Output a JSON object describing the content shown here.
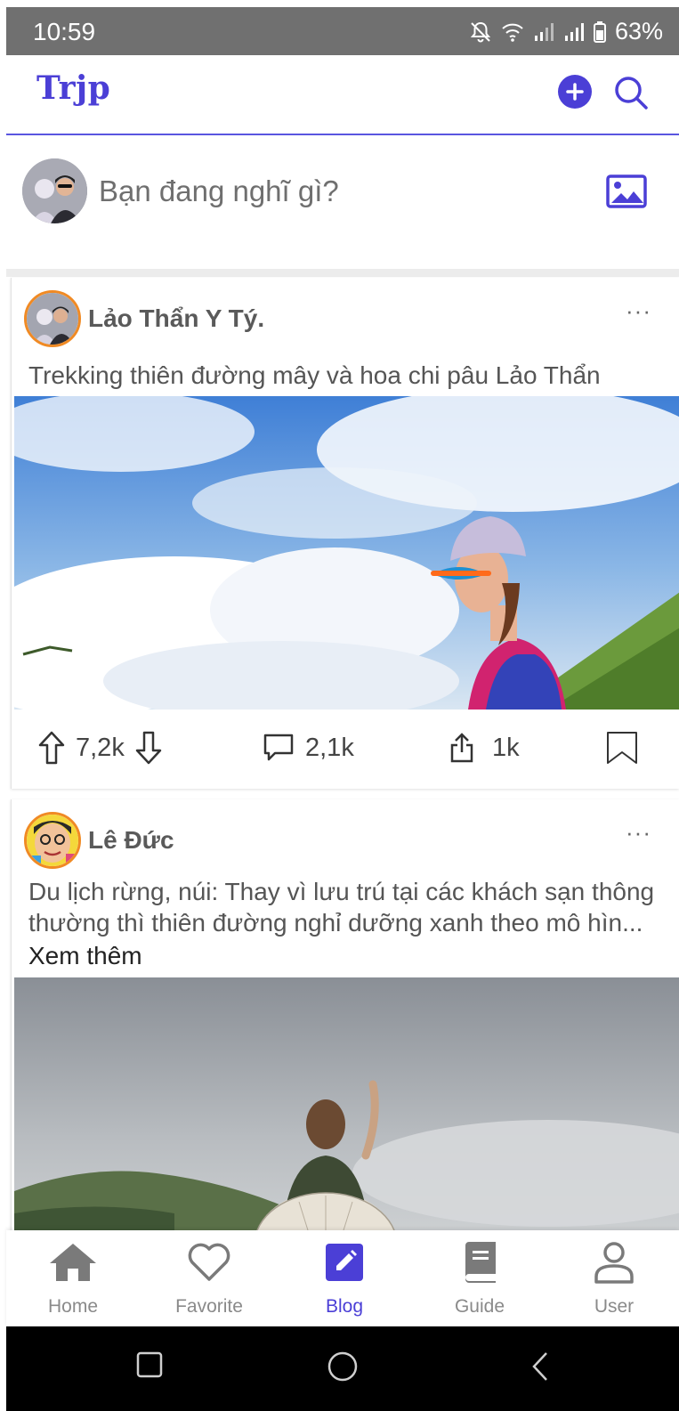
{
  "status_bar": {
    "time": "10:59",
    "battery": "63%"
  },
  "app": {
    "logo": "Trjp"
  },
  "composer": {
    "placeholder": "Bạn đang nghĩ gì?"
  },
  "posts": [
    {
      "author": "Lảo Thẩn Y Tý.",
      "more": "···",
      "caption": "Trekking thiên đường mây và hoa chi pâu Lảo Thẩn",
      "upvotes": "7,2k",
      "comments": "2,1k",
      "shares": "1k"
    },
    {
      "author": "Lê Đức",
      "more": "···",
      "caption": "Du lịch rừng, núi: Thay vì lưu trú tại các khách sạn thông thường thì thiên đường nghỉ dưỡng xanh theo mô hìn...",
      "see_more": "Xem thêm"
    }
  ],
  "bottom_nav": {
    "items": [
      {
        "label": "Home",
        "icon": "home-icon"
      },
      {
        "label": "Favorite",
        "icon": "heart-icon"
      },
      {
        "label": "Blog",
        "icon": "edit-icon",
        "active": true
      },
      {
        "label": "Guide",
        "icon": "book-icon"
      },
      {
        "label": "User",
        "icon": "user-icon"
      }
    ]
  },
  "colors": {
    "accent": "#4b3fd6",
    "status_bar": "#707070",
    "avatar_ring": "#f08a24"
  }
}
